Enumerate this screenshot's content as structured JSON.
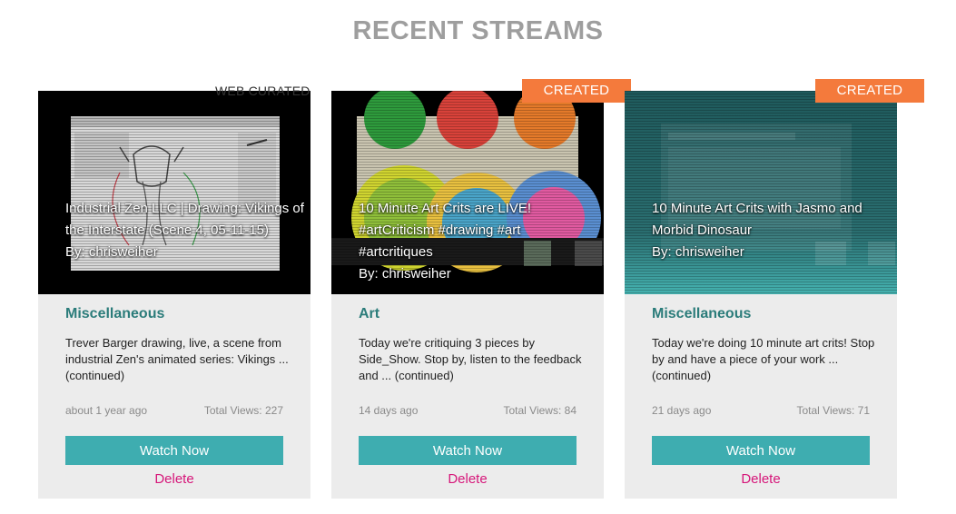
{
  "page": {
    "title": "RECENT STREAMS"
  },
  "colors": {
    "accent_teal": "#3eadb0",
    "category_teal": "#2b7c7a",
    "badge_orange": "#f47a3c",
    "delete_pink": "#d6177a"
  },
  "cards": [
    {
      "badge": "WEB CURATED",
      "title": "Industrial Zen LLC | Drawing: Vikings of the Interstate (Scene 4, 05-11-15)",
      "by": "By: chrisweiher",
      "category": "Miscellaneous",
      "description": "Trever Barger drawing, live, a scene from industrial Zen's animated series: Vikings ... (continued)",
      "time": "about 1 year ago",
      "views": "Total Views: 227",
      "watch_label": "Watch Now",
      "delete_label": "Delete"
    },
    {
      "badge": "CREATED",
      "title": "10 Minute Art Crits are LIVE! #artCriticism #drawing #art #artcritiques",
      "by": "By: chrisweiher",
      "category": "Art",
      "description": "Today we're critiquing 3 pieces by Side_Show. Stop by, listen to the feedback and ... (continued)",
      "time": "14 days ago",
      "views": "Total Views: 84",
      "watch_label": "Watch Now",
      "delete_label": "Delete"
    },
    {
      "badge": "CREATED",
      "title": "10 Minute Art Crits with Jasmo and Morbid Dinosaur",
      "by": "By: chrisweiher",
      "category": "Miscellaneous",
      "description": "Today we're doing 10 minute art crits! Stop by and have a piece of your work ... (continued)",
      "time": "21 days ago",
      "views": "Total Views: 71",
      "watch_label": "Watch Now",
      "delete_label": "Delete"
    }
  ]
}
